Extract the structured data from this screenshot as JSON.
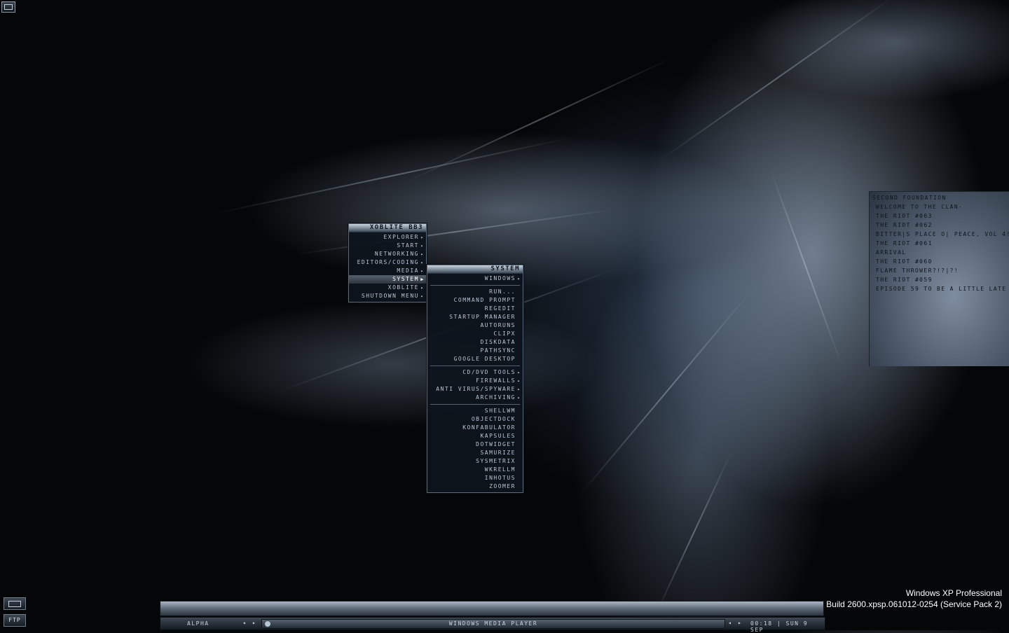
{
  "desktop": {
    "corner_icon": "window-icon"
  },
  "main_menu": {
    "title": "XOBLITE BB3",
    "items": [
      {
        "label": "EXPLORER",
        "submenu": true
      },
      {
        "label": "START",
        "submenu": true
      },
      {
        "label": "NETWORKING",
        "submenu": true
      },
      {
        "label": "EDITORS/CODING",
        "submenu": true
      },
      {
        "label": "MEDIA",
        "submenu": true
      },
      {
        "label": "SYSTEM",
        "submenu": true,
        "active": true
      },
      {
        "label": "XOBLITE",
        "submenu": true
      },
      {
        "label": "SHUTDOWN MENU",
        "submenu": true
      }
    ]
  },
  "system_menu": {
    "title": "SYSTEM",
    "group1": [
      {
        "label": "WINDOWS",
        "submenu": true
      }
    ],
    "group2": [
      {
        "label": "RUN..."
      },
      {
        "label": "COMMAND PROMPT"
      },
      {
        "label": "REGEDIT"
      },
      {
        "label": "STARTUP MANAGER"
      },
      {
        "label": "AUTORUNS"
      },
      {
        "label": "CLIPX"
      },
      {
        "label": "DISKDATA"
      },
      {
        "label": "PATHSYNC"
      },
      {
        "label": "GOOGLE DESKTOP"
      }
    ],
    "group3": [
      {
        "label": "CD/DVD TOOLS",
        "submenu": true
      },
      {
        "label": "FIREWALLS",
        "submenu": true
      },
      {
        "label": "ANTI VIRUS/SPYWARE",
        "submenu": true
      },
      {
        "label": "ARCHIVING",
        "submenu": true
      }
    ],
    "group4": [
      {
        "label": "SHELLWM"
      },
      {
        "label": "OBJECTDOCK"
      },
      {
        "label": "KONFABULATOR"
      },
      {
        "label": "KAPSULES"
      },
      {
        "label": "DOTWIDGET"
      },
      {
        "label": "SAMURIZE"
      },
      {
        "label": "SYSMETRIX"
      },
      {
        "label": "WKRELLM"
      },
      {
        "label": "INHOTUS"
      },
      {
        "label": "ZOOMER"
      }
    ]
  },
  "rss_panel": {
    "header": "SECOND FOUNDATION",
    "items": [
      "WELCOME TO THE CLAN-",
      "THE RIOT #063",
      "THE RIOT #062",
      "BITTER|S PLACE O| PEACE, VOL 4!",
      "THE RIOT #061",
      "ARRIVAL",
      "THE RIOT #060",
      "FLAME THROWER?!?|?!",
      "THE RIOT #059",
      "EPISODE 59 TO BE A LITTLE LATE"
    ]
  },
  "system_info": {
    "os_name": "Windows XP Professional",
    "build": "Build 2600.xpsp.061012-0254 (Service Pack 2)"
  },
  "taskbar": {
    "workspace": "ALPHA",
    "window_title": "WINDOWS MEDIA PLAYER",
    "clock": "00:18 | SUN 9 SEP",
    "prev_symbol": "◂",
    "next_symbol": "▸"
  },
  "quick_buttons": {
    "top_icon": "keyboard-icon",
    "ftp_label": "FTP"
  }
}
